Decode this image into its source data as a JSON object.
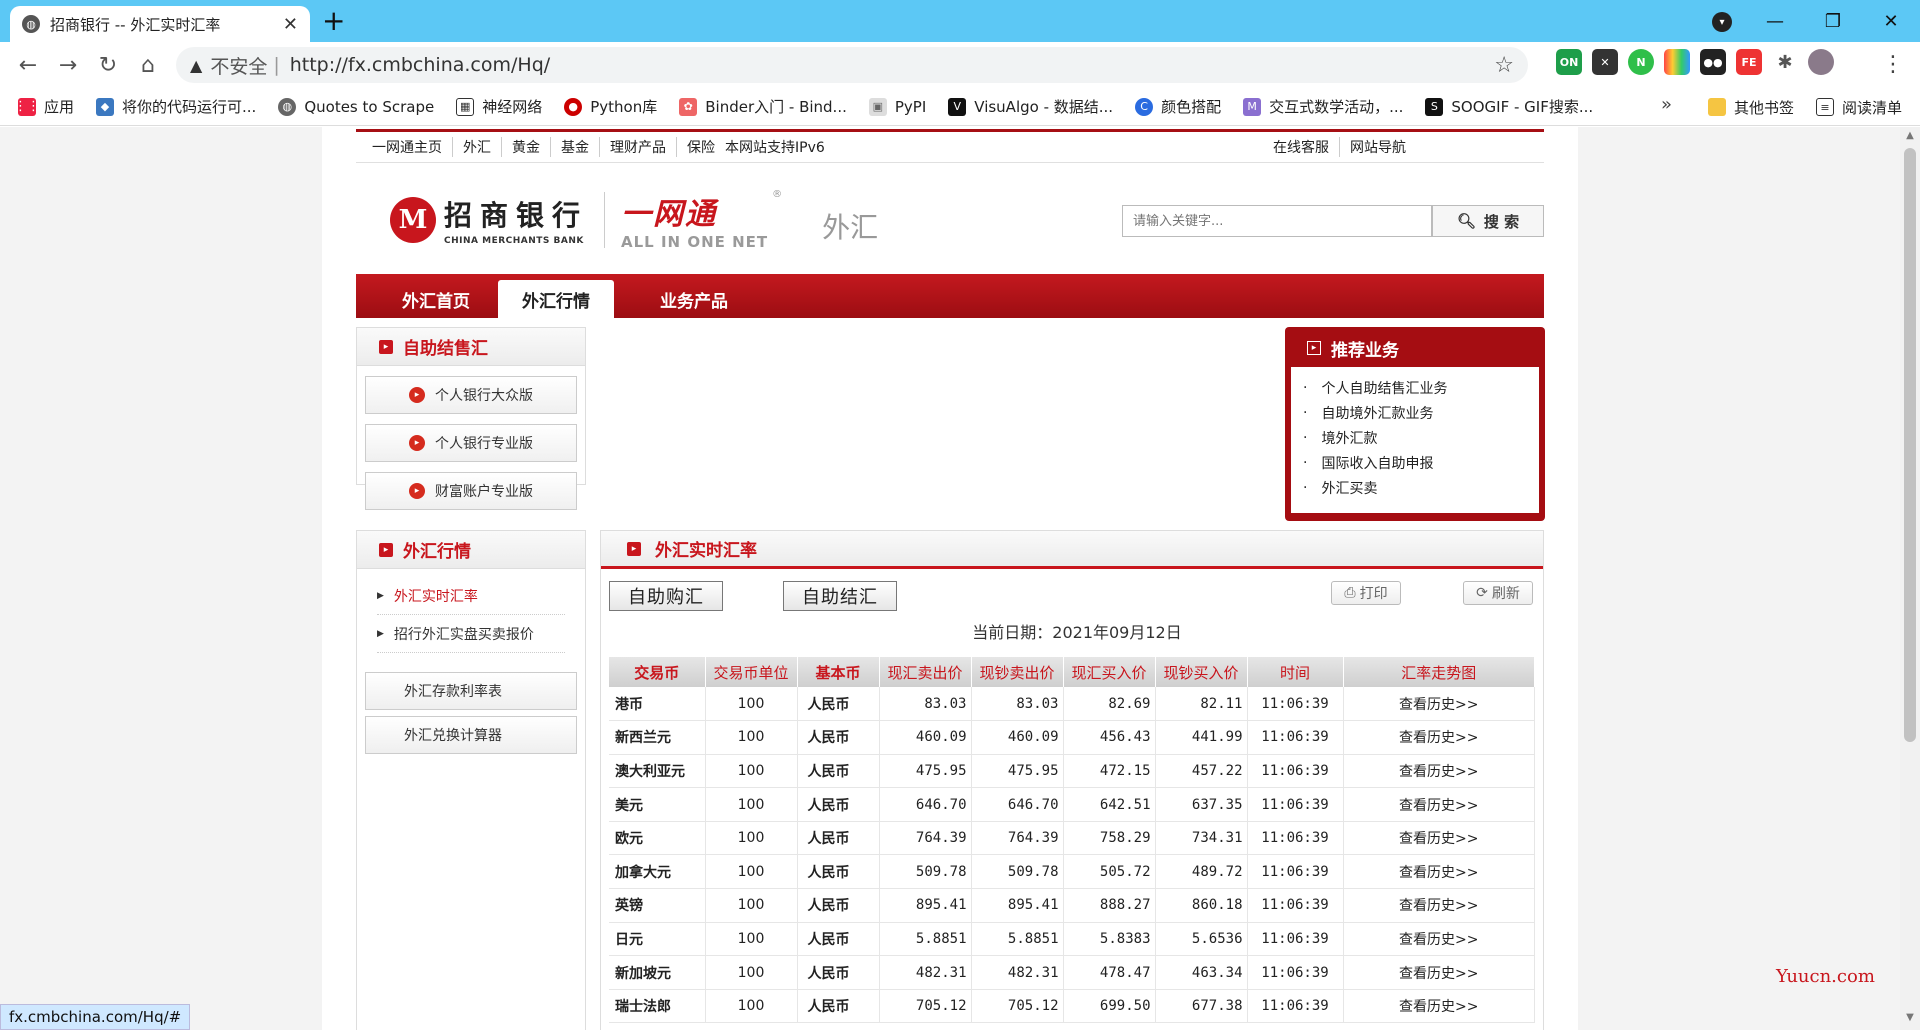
{
  "browser": {
    "tab_title": "招商银行 -- 外汇实时汇率",
    "omnibox": {
      "insecure": "不安全",
      "url": "http://fx.cmbchina.com/Hq/"
    },
    "bookmarks": [
      "应用",
      "将你的代码运行可...",
      "Quotes to Scrape",
      "神经网络",
      "Python库",
      "Binder入门 - Bind...",
      "PyPI",
      "VisuAlgo - 数据结...",
      "颜色搭配",
      "交互式数学活动，...",
      "SOOGIF - GIF搜索..."
    ],
    "bookmarks_right": {
      "other": "其他书签",
      "reading": "阅读清单"
    },
    "status_url": "fx.cmbchina.com/Hq/#"
  },
  "page": {
    "topnav_left": [
      "一网通主页",
      "外汇",
      "黄金",
      "基金",
      "理财产品",
      "保险"
    ],
    "ipv6": "本网站支持IPv6",
    "topnav_right": [
      "在线客服",
      "网站导航"
    ],
    "logo": {
      "cn": "招商银行",
      "en": "CHINA MERCHANTS BANK",
      "ywt_cn": "一网通",
      "ywt_en": "ALL IN ONE NET",
      "sub": "外汇"
    },
    "search": {
      "placeholder": "请输入关键字...",
      "button": "搜 索"
    },
    "mainnav": [
      "外汇首页",
      "外汇行情",
      "业务产品"
    ],
    "left_box1": {
      "title": "自助结售汇",
      "buttons": [
        "个人银行大众版",
        "个人银行专业版",
        "财富账户专业版"
      ]
    },
    "left_box2": {
      "title": "外汇行情",
      "links": [
        "外汇实时汇率",
        "招行外汇实盘买卖报价"
      ]
    },
    "left_tools": [
      "外汇存款利率表",
      "外汇兑换计算器"
    ],
    "recommend": {
      "title": "推荐业务",
      "items": [
        "个人自助结售汇业务",
        "自助境外汇款业务",
        "境外汇款",
        "国际收入自助申报",
        "外汇买卖"
      ]
    },
    "rates": {
      "title": "外汇实时汇率",
      "btn_buy": "自助购汇",
      "btn_sell": "自助结汇",
      "print": "打印",
      "refresh": "刷新",
      "date_label": "当前日期：",
      "date": "2021年09月12日",
      "headers": [
        "交易币",
        "交易币单位",
        "基本币",
        "现汇卖出价",
        "现钞卖出价",
        "现汇买入价",
        "现钞买入价",
        "时间",
        "汇率走势图"
      ],
      "rows": [
        [
          "港币",
          "100",
          "人民币",
          "83.03",
          "83.03",
          "82.69",
          "82.11",
          "11:06:39",
          "查看历史>>"
        ],
        [
          "新西兰元",
          "100",
          "人民币",
          "460.09",
          "460.09",
          "456.43",
          "441.99",
          "11:06:39",
          "查看历史>>"
        ],
        [
          "澳大利亚元",
          "100",
          "人民币",
          "475.95",
          "475.95",
          "472.15",
          "457.22",
          "11:06:39",
          "查看历史>>"
        ],
        [
          "美元",
          "100",
          "人民币",
          "646.70",
          "646.70",
          "642.51",
          "637.35",
          "11:06:39",
          "查看历史>>"
        ],
        [
          "欧元",
          "100",
          "人民币",
          "764.39",
          "764.39",
          "758.29",
          "734.31",
          "11:06:39",
          "查看历史>>"
        ],
        [
          "加拿大元",
          "100",
          "人民币",
          "509.78",
          "509.78",
          "505.72",
          "489.72",
          "11:06:39",
          "查看历史>>"
        ],
        [
          "英镑",
          "100",
          "人民币",
          "895.41",
          "895.41",
          "888.27",
          "860.18",
          "11:06:39",
          "查看历史>>"
        ],
        [
          "日元",
          "100",
          "人民币",
          "5.8851",
          "5.8851",
          "5.8383",
          "5.6536",
          "11:06:39",
          "查看历史>>"
        ],
        [
          "新加坡元",
          "100",
          "人民币",
          "482.31",
          "482.31",
          "478.47",
          "463.34",
          "11:06:39",
          "查看历史>>"
        ],
        [
          "瑞士法郎",
          "100",
          "人民币",
          "705.12",
          "705.12",
          "699.50",
          "677.38",
          "11:06:39",
          "查看历史>>"
        ]
      ]
    },
    "watermark": "Yuucn.com"
  }
}
